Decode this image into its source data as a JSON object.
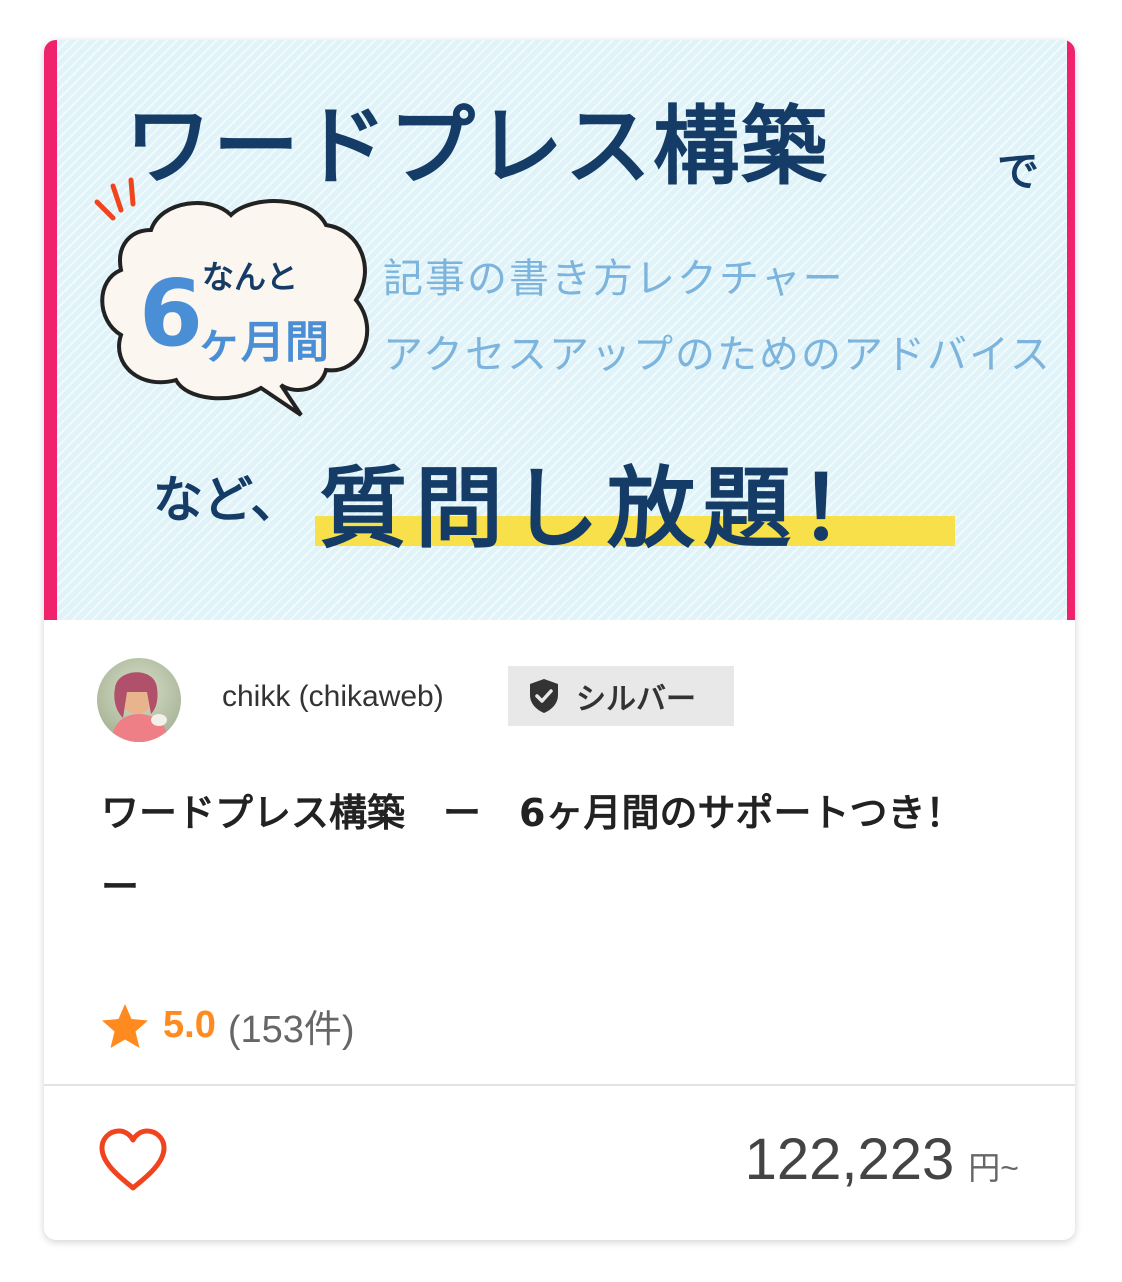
{
  "hero": {
    "title": "ワードプレス構築",
    "title_suffix": "で",
    "bubble_small": "なんと",
    "bubble_number": "6",
    "bubble_unit": "ヶ月間",
    "sub_line_1": "記事の書き方レクチャー",
    "sub_line_2": "アクセスアップのためのアドバイス",
    "prefix": "など、",
    "main": "質問し放題！"
  },
  "seller": {
    "name": "chikk (chikaweb)",
    "badge_label": "シルバー",
    "badge_icon": "shield-check-icon"
  },
  "service": {
    "title": "ワードプレス構築　ー　6ヶ月間のサポートつき！　ー"
  },
  "rating": {
    "score": "5.0",
    "count": "(153件)"
  },
  "price": {
    "value": "122,223",
    "unit": "円~"
  },
  "colors": {
    "accent_pink": "#f0226c",
    "rating_orange": "#ff8a1f",
    "favorite_red": "#f0441f",
    "hero_navy": "#143c66",
    "hero_blue": "#4a8fd6",
    "highlight_yellow": "#f7e04a"
  }
}
